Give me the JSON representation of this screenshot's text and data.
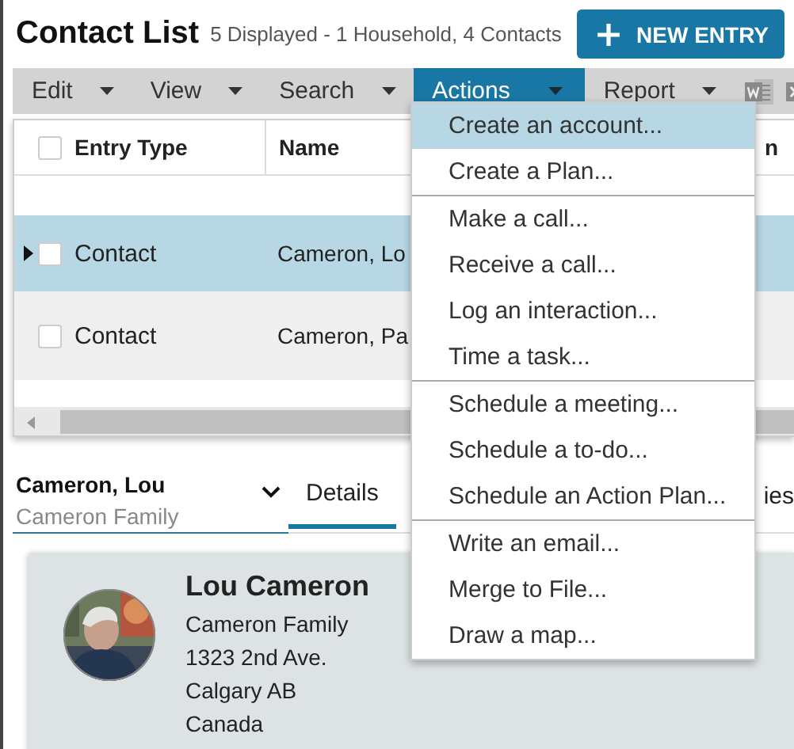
{
  "header": {
    "title": "Contact List",
    "summary": "5 Displayed - 1 Household, 4 Contacts",
    "new_button": "NEW ENTRY"
  },
  "toolbar": {
    "menus": [
      {
        "label": "Edit",
        "selected": false
      },
      {
        "label": "View",
        "selected": false
      },
      {
        "label": "Search",
        "selected": false
      },
      {
        "label": "Actions",
        "selected": true
      },
      {
        "label": "Report",
        "selected": false
      }
    ]
  },
  "table": {
    "all_selected": false,
    "columns": [
      "Entry Type",
      "Name",
      "n"
    ],
    "rows": [
      {
        "entry_type": "Contact",
        "name": "Cameron, Lo",
        "selected": true,
        "checked": false
      },
      {
        "entry_type": "Contact",
        "name": "Cameron, Pa",
        "selected": false,
        "checked": false
      }
    ]
  },
  "record": {
    "name": "Cameron, Lou",
    "household": "Cameron Family",
    "tabs": [
      {
        "label": "Details",
        "selected": true
      },
      {
        "label": "ies",
        "selected": false
      }
    ],
    "card": {
      "name": "Lou Cameron",
      "lines": [
        "Cameron Family",
        "1323 2nd Ave.",
        "Calgary AB",
        "Canada"
      ]
    }
  },
  "actions_menu": {
    "groups": [
      [
        {
          "label": "Create an account...",
          "selected": true
        },
        {
          "label": "Create a Plan...",
          "selected": false
        }
      ],
      [
        {
          "label": "Make a call...",
          "selected": false
        },
        {
          "label": "Receive a call...",
          "selected": false
        },
        {
          "label": "Log an interaction...",
          "selected": false
        },
        {
          "label": "Time a task...",
          "selected": false
        }
      ],
      [
        {
          "label": "Schedule a meeting...",
          "selected": false
        },
        {
          "label": "Schedule a to-do...",
          "selected": false
        },
        {
          "label": "Schedule an Action Plan...",
          "selected": false
        }
      ],
      [
        {
          "label": "Write an email...",
          "selected": false
        },
        {
          "label": "Merge to File...",
          "selected": false
        },
        {
          "label": "Draw a map...",
          "selected": false
        }
      ]
    ]
  }
}
